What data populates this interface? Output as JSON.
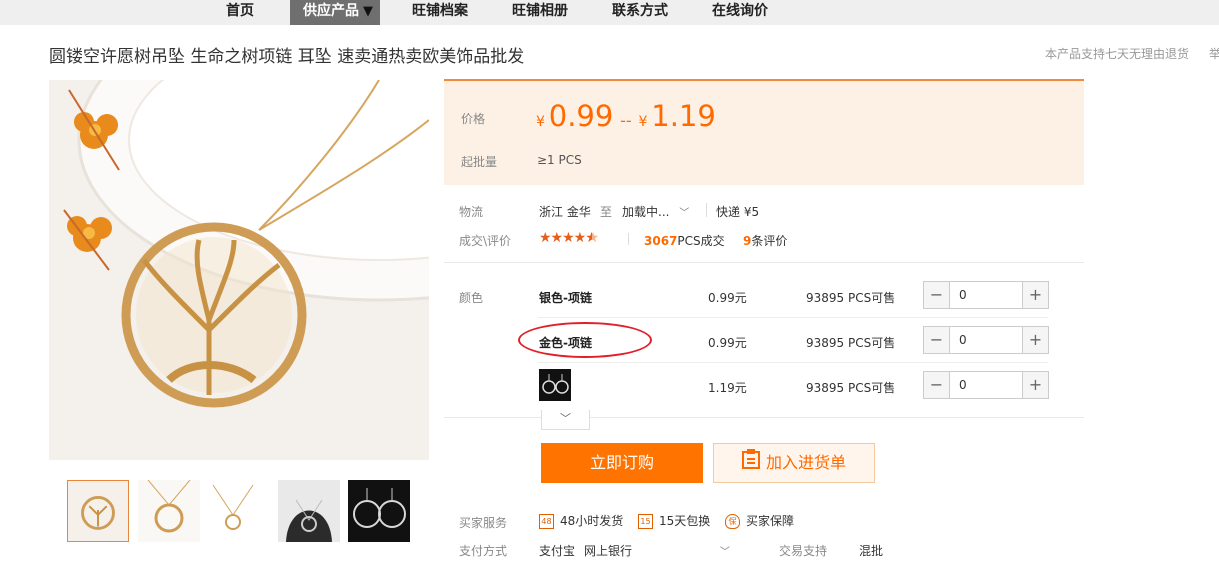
{
  "nav": {
    "home": "首页",
    "products": "供应产品",
    "archive": "旺铺档案",
    "album": "旺铺相册",
    "contact": "联系方式",
    "inquiry": "在线询价"
  },
  "title": "圆镂空许愿树吊坠 生命之树项链 耳坠 速卖通热卖欧美饰品批发",
  "return_note": "本产品支持七天无理由退货",
  "return_note_cut": "举",
  "price": {
    "label": "价格",
    "currency": "¥",
    "low": "0.99",
    "sep": "--",
    "high": "1.19",
    "moq_label": "起批量",
    "moq_value": "≥1 PCS"
  },
  "logistics": {
    "label": "物流",
    "from": "浙江 金华",
    "to_word": "至",
    "destination": "加载中...",
    "express": "快递 ¥5"
  },
  "deals": {
    "label": "成交\\评价",
    "rating": 4.5,
    "count": "3067",
    "count_suffix": "PCS成交",
    "reviews": "9",
    "reviews_suffix": "条评价"
  },
  "sku": {
    "label": "颜色",
    "rows": [
      {
        "name": "银色-项链",
        "price": "0.99元",
        "stock": "93895 PCS可售",
        "qty": "0"
      },
      {
        "name": "金色-项链",
        "price": "0.99元",
        "stock": "93895 PCS可售",
        "qty": "0"
      },
      {
        "name": "",
        "price": "1.19元",
        "stock": "93895 PCS可售",
        "qty": "0"
      }
    ]
  },
  "actions": {
    "buy": "立即订购",
    "cart": "加入进货单"
  },
  "services": {
    "label": "买家服务",
    "items": [
      {
        "icon": "48",
        "text": "48小时发货"
      },
      {
        "icon": "15",
        "text": "15天包换"
      },
      {
        "icon": "保",
        "text": "买家保障"
      }
    ]
  },
  "payment": {
    "label": "支付方式",
    "methods": "支付宝",
    "bank": "网上银行",
    "support_label": "交易支持",
    "support_value": "混批"
  },
  "colors": {
    "accent": "#ff6a00",
    "buy_button": "#ff7300",
    "price_bg": "#fdf1e6",
    "annotation": "#e0202a"
  }
}
